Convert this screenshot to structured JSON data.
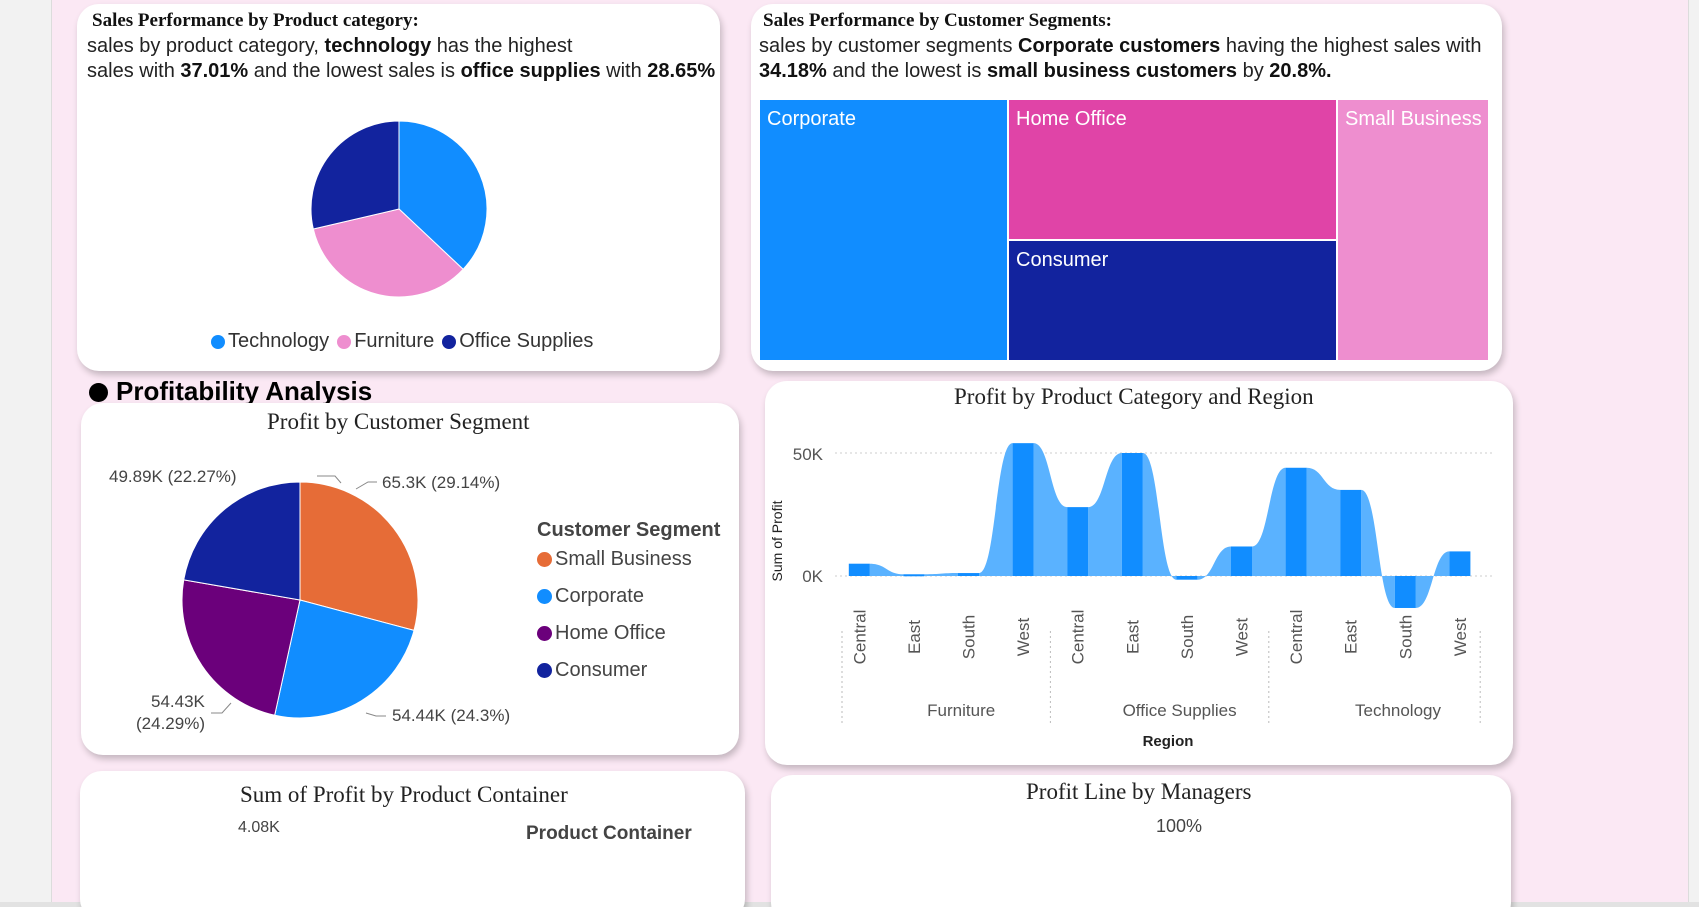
{
  "colors": {
    "page_bg": "#fbe8f4",
    "blue": "#118dff",
    "navy": "#12239e",
    "pink": "#e044a7",
    "light_pink": "#ee8ecf",
    "orange": "#e66c37",
    "purple": "#6b007b",
    "ribbon": "#5ab2ff"
  },
  "card_category": {
    "title": "Sales Performance by Product category:",
    "line1_a": "sales by product category, ",
    "line1_b": "technology",
    "line1_c": " has the highest",
    "line2_a": "sales with ",
    "line2_b": "37.01%",
    "line2_c": " and the lowest sales is ",
    "line2_d": "office supplies",
    "line2_e": " with ",
    "line2_f": "28.65%",
    "legend": [
      {
        "label": "Technology",
        "color": "#118dff"
      },
      {
        "label": "Furniture",
        "color": "#ee8ecf"
      },
      {
        "label": "Office Supplies",
        "color": "#12239e"
      }
    ]
  },
  "card_segments": {
    "title": "Sales Performance by Customer Segments:",
    "line1_a": "sales by customer segments ",
    "line1_b": "Corporate customers",
    "line1_c": " having the highest sales with",
    "line2_a": "34.18%",
    "line2_b": " and the lowest is ",
    "line2_c": "small business customers",
    "line2_d": " by ",
    "line2_e": "20.8%.",
    "treemap": [
      {
        "label": "Corporate",
        "color": "#118dff"
      },
      {
        "label": "Home Office",
        "color": "#e044a7"
      },
      {
        "label": "Consumer",
        "color": "#12239e"
      },
      {
        "label": "Small Business",
        "color": "#ee8ecf"
      }
    ]
  },
  "section": {
    "title": "Profitability Analysis"
  },
  "card_profit_segment": {
    "title": "Profit by Customer Segment",
    "legend_title": "Customer Segment",
    "labels": {
      "small_business": "65.3K (29.14%)",
      "corporate": "54.44K (24.3%)",
      "home_office_1": "54.43K",
      "home_office_2": "(24.29%)",
      "consumer": "49.89K (22.27%)"
    },
    "legend": [
      {
        "label": "Small Business",
        "color": "#e66c37"
      },
      {
        "label": "Corporate",
        "color": "#118dff"
      },
      {
        "label": "Home Office",
        "color": "#6b007b"
      },
      {
        "label": "Consumer",
        "color": "#12239e"
      }
    ]
  },
  "card_region": {
    "title": "Profit by Product Category and Region",
    "ylabel": "Sum of Profit",
    "xlabel": "Region",
    "yticks": [
      "50K",
      "0K"
    ]
  },
  "card_container": {
    "title": "Sum of Profit by Product Container",
    "value": "4.08K",
    "legend_title": "Product Container"
  },
  "card_managers": {
    "title": "Profit Line by Managers",
    "value": "100%"
  },
  "chart_data": [
    {
      "type": "pie",
      "categories": [
        "Technology",
        "Furniture",
        "Office Supplies"
      ],
      "values": [
        37.01,
        34.34,
        28.65
      ],
      "colors": [
        "#118dff",
        "#ee8ecf",
        "#12239e"
      ],
      "legend": "bottom"
    },
    {
      "type": "treemap",
      "categories": [
        "Corporate",
        "Home Office",
        "Consumer",
        "Small Business"
      ],
      "values": [
        34.18,
        25.3,
        19.7,
        20.8
      ],
      "colors": [
        "#118dff",
        "#e044a7",
        "#12239e",
        "#ee8ecf"
      ]
    },
    {
      "type": "pie",
      "title": "Profit by Customer Segment",
      "categories": [
        "Small Business",
        "Corporate",
        "Home Office",
        "Consumer"
      ],
      "values": [
        65300,
        54440,
        54430,
        49890
      ],
      "percent": [
        29.14,
        24.3,
        24.29,
        22.27
      ],
      "colors": [
        "#e66c37",
        "#118dff",
        "#6b007b",
        "#12239e"
      ],
      "legend": "right"
    },
    {
      "type": "bar",
      "subtype": "ribbon",
      "title": "Profit by Product Category and Region",
      "xlabel": "Region",
      "ylabel": "Sum of Profit",
      "groups": [
        "Furniture",
        "Office Supplies",
        "Technology"
      ],
      "categories": [
        "Central",
        "East",
        "South",
        "West",
        "Central",
        "East",
        "South",
        "West",
        "Central",
        "East",
        "South",
        "West"
      ],
      "values": [
        5000,
        700,
        1200,
        54000,
        28000,
        50000,
        -1500,
        12000,
        44000,
        35000,
        -13000,
        10000
      ],
      "ylim": [
        -15000,
        55000
      ],
      "yticks": [
        0,
        50000
      ],
      "grid": true
    }
  ]
}
